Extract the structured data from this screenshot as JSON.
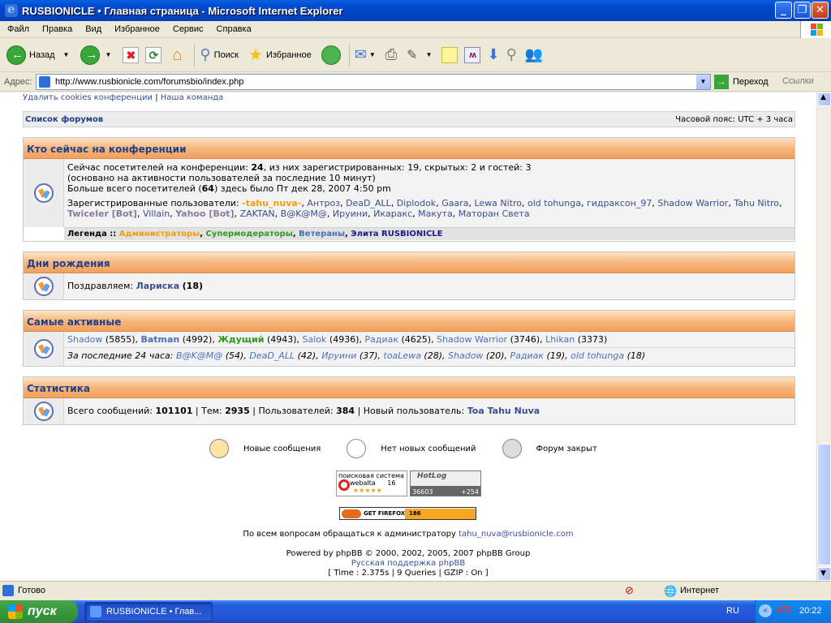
{
  "window": {
    "title": "RUSBIONICLE • Главная страница - Microsoft Internet Explorer"
  },
  "menu": [
    "Файл",
    "Правка",
    "Вид",
    "Избранное",
    "Сервис",
    "Справка"
  ],
  "toolbar": {
    "back": "Назад",
    "search": "Поиск",
    "favorites": "Избранное"
  },
  "address": {
    "label": "Адрес:",
    "url": "http://www.rusbionicle.com/forumsbio/index.php",
    "go": "Переход",
    "links": "Ссылки"
  },
  "page": {
    "top_links": {
      "delete_cookies": "Удалить cookies конференции",
      "sep": "|",
      "team": "Наша команда"
    },
    "nav": {
      "forum_list": "Список форумов",
      "timezone": "Часовой пояс: UTC + 3 часа"
    },
    "online": {
      "header": "Кто сейчас на конференции",
      "line1_a": "Сейчас посетителей на конференции: ",
      "line1_count": "24",
      "line1_b": ", из них зарегистрированных: 19, скрытых: 2 и гостей: 3",
      "line2": "(основано на активности пользователей за последние 10 минут)",
      "line3_a": "Больше всего посетителей (",
      "line3_count": "64",
      "line3_b": ") здесь было Пт дек 28, 2007 4:50 pm",
      "registered_label": "Зарегистрированные пользователи:",
      "users": [
        {
          "name": "-tahu_nuva-",
          "cls": "orange"
        },
        {
          "name": "Антроз",
          "cls": "lnk"
        },
        {
          "name": "DeaD_ALL",
          "cls": "lnk"
        },
        {
          "name": "Diplodok",
          "cls": "lnk"
        },
        {
          "name": "Gaara",
          "cls": "lnk"
        },
        {
          "name": "Lewa Nitro",
          "cls": "lnk"
        },
        {
          "name": "old tohunga",
          "cls": "lnk"
        },
        {
          "name": "гидраксон_97",
          "cls": "lnk"
        },
        {
          "name": "Shadow Warrior",
          "cls": "lnk"
        },
        {
          "name": "Tahu Nitro",
          "cls": "lnk"
        },
        {
          "name": "Twiceler [Bot]",
          "cls": "grey"
        },
        {
          "name": "Villain",
          "cls": "lnk"
        },
        {
          "name": "Yahoo [Bot]",
          "cls": "grey"
        },
        {
          "name": "ZAKTAN",
          "cls": "lnk"
        },
        {
          "name": "B@K@M@",
          "cls": "lnk"
        },
        {
          "name": "Ируини",
          "cls": "lnk"
        },
        {
          "name": "Икаракс",
          "cls": "lnk"
        },
        {
          "name": "Макута",
          "cls": "lnk"
        },
        {
          "name": "Маторан Света",
          "cls": "lnk"
        }
      ],
      "legend_label": "Легенда ::",
      "legend_admins": "Администраторы",
      "legend_supermods": "Супермодераторы",
      "legend_veterans": "Ветераны",
      "legend_elite": "Элита RUSBIONICLE"
    },
    "birthdays": {
      "header": "Дни рождения",
      "congrats": "Поздравляем:",
      "name": "Лариска",
      "age": "(18)"
    },
    "active": {
      "header": "Самые активные",
      "top": [
        {
          "name": "Shadow",
          "count": "(5855)",
          "cls": "blue"
        },
        {
          "name": "Batman",
          "count": "(4992)",
          "cls": "blue b"
        },
        {
          "name": "Ждущий",
          "count": "(4943)",
          "cls": "green"
        },
        {
          "name": "Salok",
          "count": "(4936)",
          "cls": "blue"
        },
        {
          "name": "Радиак",
          "count": "(4625)",
          "cls": "blue"
        },
        {
          "name": "Shadow Warrior",
          "count": "(3746)",
          "cls": "blue"
        },
        {
          "name": "Lhikan",
          "count": "(3373)",
          "cls": "blue"
        }
      ],
      "last24_label": "За последние 24 часа:",
      "last24": [
        {
          "name": "B@K@M@",
          "count": "(54)"
        },
        {
          "name": "DeaD_ALL",
          "count": "(42)"
        },
        {
          "name": "Ируини",
          "count": "(37)"
        },
        {
          "name": "toaLewa",
          "count": "(28)"
        },
        {
          "name": "Shadow",
          "count": "(20)"
        },
        {
          "name": "Радиак",
          "count": "(19)"
        },
        {
          "name": "old tohunga",
          "count": "(18)"
        }
      ]
    },
    "stats": {
      "header": "Статистика",
      "posts_label": "Всего сообщений:",
      "posts": "101101",
      "topics_label": "Тем:",
      "topics": "2935",
      "users_label": "Пользователей:",
      "users": "384",
      "newest_label": "Новый пользователь:",
      "newest": "Toa Tahu Nuva"
    },
    "legend_icons": {
      "new": "Новые сообщения",
      "no_new": "Нет новых сообщений",
      "locked": "Форум закрыт"
    },
    "badges": {
      "webalta_line1": "поисковая система",
      "webalta_line2": "webalta",
      "webalta_num": "16",
      "hotlog": "HotLog",
      "hotlog_total": "36603",
      "hotlog_today": "+254",
      "firefox": "GET FIREFOX",
      "firefox_count": "186"
    },
    "contact_text": "По всем вопросам обращаться к администратору",
    "contact_email": "tahu_nuva@rusbionicle.com",
    "powered": "Powered by phpBB © 2000, 2002, 2005, 2007 phpBB Group",
    "support": "Русская поддержка phpBB",
    "timing": "[ Time : 2.375s | 9 Queries | GZIP : On ]"
  },
  "status": {
    "ready": "Готово",
    "zone": "Интернет"
  },
  "taskbar": {
    "start": "пуск",
    "task": "RUSBIONICLE • Глав...",
    "lang": "RU",
    "clock": "20:22"
  }
}
